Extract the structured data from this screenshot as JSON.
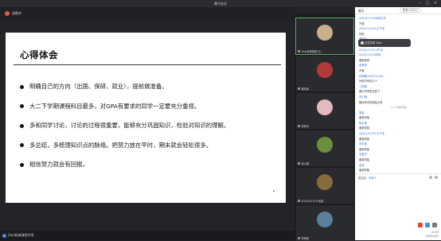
{
  "window": {
    "title": "腾讯会议"
  },
  "share": {
    "presenter": "渣数学"
  },
  "slide": {
    "title": "心得体会",
    "bullets": [
      "明确自己的方向（出国、保研、就业），提前做准备。",
      "大二下学期课程科目最多，对GPA有要求的同学一定要充分重视。",
      "多和同学讨论，讨论的过程很重要，能够充分巩固知识，检验对知识的理解。",
      "多总结，多梳理知识点的脉络。把努力放在平时，期末就会轻松很多。",
      "相信努力就会有回报。"
    ]
  },
  "participants": [
    {
      "name": "Zexi机械课室(主)",
      "avatar_color": "#c9b08a"
    },
    {
      "name": "鞠婧维",
      "avatar_color": "#b43a3a"
    },
    {
      "name": "李昊东",
      "avatar_color": "#e6b8c0"
    },
    {
      "name": "吴小唐",
      "avatar_color": "#6a8f3a"
    },
    {
      "name": "2020211579-伯瑞",
      "avatar_color": "#8a6b3c"
    },
    {
      "name": "李明阳",
      "avatar_color": "#5c7f9e"
    }
  ],
  "bottom": {
    "camera_label": "Zexi机械课堂共享"
  },
  "chat": {
    "header_title": "聊天",
    "header_pill": "所有人(251)",
    "toast_text": "正在共享 Zexi",
    "messages": [
      {
        "kind": "sender",
        "text": "2020211534林晓文字"
      },
      {
        "kind": "msg",
        "text": "不想"
      },
      {
        "kind": "sender",
        "text": "2020211295-王子浩"
      },
      {
        "kind": "msg",
        "text": "好的"
      },
      {
        "kind": "sender",
        "text": "谭晓东"
      },
      {
        "kind": "msg",
        "text": "好像那个事情"
      },
      {
        "kind": "sender",
        "text": "2020211551-邓 铭"
      },
      {
        "kind": "sender",
        "text": "2020211535林依"
      },
      {
        "kind": "msg",
        "text": "谢谢老师"
      },
      {
        "kind": "sender",
        "text": "张雨婷"
      },
      {
        "kind": "msg",
        "text": "不客"
      },
      {
        "kind": "sender",
        "text": "任明敏2020211051"
      },
      {
        "kind": "msg",
        "text": "好像只有前几个"
      },
      {
        "kind": "sender",
        "text": "三国演"
      },
      {
        "kind": "msg",
        "text": "我们不同意这样了"
      },
      {
        "kind": "sender",
        "text": "刘小楠"
      },
      {
        "kind": "msg",
        "text": "期待你们的经验分享"
      },
      {
        "kind": "sys",
        "text": "以下为新消息"
      },
      {
        "kind": "sender",
        "text": "周晓"
      },
      {
        "kind": "msg",
        "text": "谢谢学姐"
      },
      {
        "kind": "sender",
        "text": "杨女神"
      },
      {
        "kind": "msg",
        "text": "谢谢学姐"
      },
      {
        "kind": "sender",
        "text": "2020211295-王子浩"
      },
      {
        "kind": "msg",
        "text": "谢谢学姐"
      },
      {
        "kind": "sender",
        "text": "安学姐"
      },
      {
        "kind": "msg",
        "text": "谢谢学姐"
      },
      {
        "kind": "sender",
        "text": "刘美东"
      },
      {
        "kind": "msg",
        "text": "谢谢学姐"
      },
      {
        "kind": "sender",
        "text": "张晓"
      },
      {
        "kind": "msg",
        "text": "谢谢学姐"
      },
      {
        "kind": "sender",
        "text": "刘小楠"
      },
      {
        "kind": "msg",
        "text": "谢谢学姐"
      }
    ],
    "send_to_label": "发送至：",
    "send_to_value": "所有人"
  },
  "clock": {
    "time": "21:03",
    "date": "2022/4/27"
  }
}
